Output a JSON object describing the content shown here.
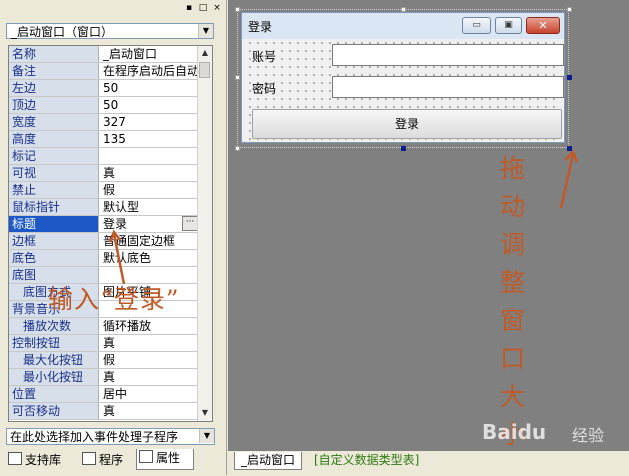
{
  "panel": {
    "object_selector": "_启动窗口（窗口）",
    "event_selector": "在此处选择加入事件处理子程序",
    "titlebar_buttons": [
      "▪",
      "□",
      "×"
    ]
  },
  "properties": [
    {
      "name": "名称",
      "value": "_启动窗口",
      "sub": false
    },
    {
      "name": "备注",
      "value": "在程序启动后自动",
      "sub": false
    },
    {
      "name": "左边",
      "value": "50",
      "sub": false
    },
    {
      "name": "顶边",
      "value": "50",
      "sub": false
    },
    {
      "name": "宽度",
      "value": "327",
      "sub": false
    },
    {
      "name": "高度",
      "value": "135",
      "sub": false
    },
    {
      "name": "标记",
      "value": "",
      "sub": false
    },
    {
      "name": "可视",
      "value": "真",
      "sub": false
    },
    {
      "name": "禁止",
      "value": "假",
      "sub": false
    },
    {
      "name": "鼠标指针",
      "value": "默认型",
      "sub": false
    },
    {
      "name": "标题",
      "value": "登录",
      "sub": false,
      "selected": true,
      "ellipsis": "···"
    },
    {
      "name": "边框",
      "value": "普通固定边框",
      "sub": false
    },
    {
      "name": "底色",
      "value": "默认底色",
      "sub": false
    },
    {
      "name": "底图",
      "value": "",
      "sub": false
    },
    {
      "name": "底图方式",
      "value": "图片平铺",
      "sub": true
    },
    {
      "name": "背景音乐",
      "value": "",
      "sub": false
    },
    {
      "name": "播放次数",
      "value": "循环播放",
      "sub": true
    },
    {
      "name": "控制按钮",
      "value": "真",
      "sub": false
    },
    {
      "name": "最大化按钮",
      "value": "假",
      "sub": true
    },
    {
      "name": "最小化按钮",
      "value": "真",
      "sub": true
    },
    {
      "name": "位置",
      "value": "居中",
      "sub": false
    },
    {
      "name": "可否移动",
      "value": "真",
      "sub": false
    }
  ],
  "panel_tabs": [
    "支持库",
    "程序",
    "属性"
  ],
  "form": {
    "title": "登录",
    "window_buttons": [
      "▭",
      "▣",
      "✕"
    ],
    "account_label": "账号",
    "password_label": "密码",
    "login_button": "登录"
  },
  "annotations": {
    "input_hint": "输入“登录”",
    "drag_hint": "拖动调整窗口大小"
  },
  "doc_tabs": [
    "_启动窗口",
    "[自定义数据类型表]"
  ],
  "watermark": {
    "brand": "Baidu",
    "label": "经验"
  },
  "colors": {
    "selected_row": "#1c59c6",
    "annotation": "#c05a26",
    "designer_bg": "#808080"
  }
}
